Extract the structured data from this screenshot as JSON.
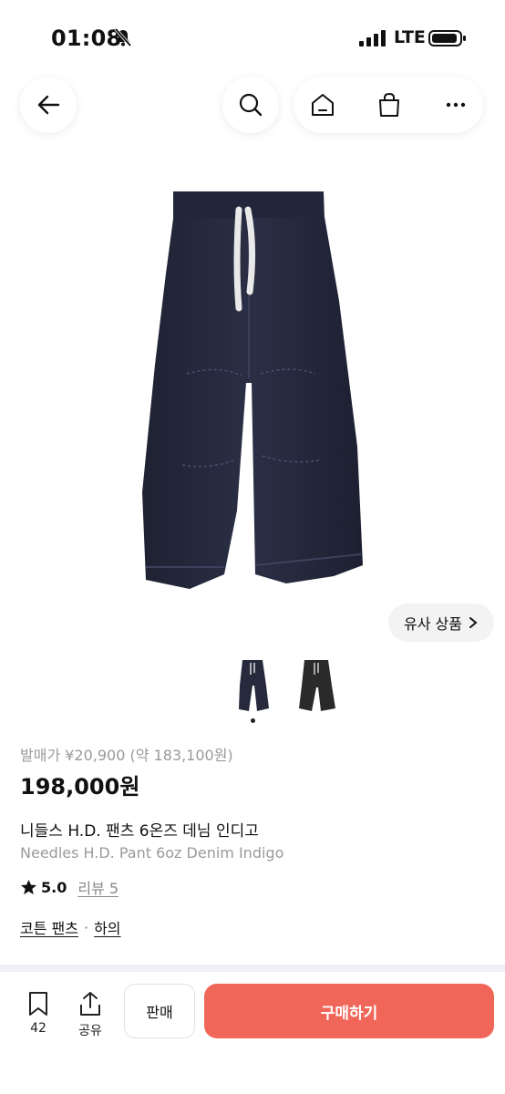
{
  "status": {
    "time": "01:08",
    "network": "LTE"
  },
  "nav": {
    "icons": [
      "back-arrow-icon",
      "search-icon",
      "home-icon",
      "shopping-bag-icon",
      "more-icon"
    ]
  },
  "gallery": {
    "similar_label": "유사 상품",
    "thumbnail_count": 2,
    "active_index": 0
  },
  "product": {
    "original_price": "발매가 ¥20,900 (약 183,100원)",
    "price": "198,000원",
    "title_ko": "니들스 H.D. 팬츠 6온즈 데님 인디고",
    "title_en": "Needles H.D. Pant 6oz Denim Indigo",
    "rating": "5.0",
    "review_label": "리뷰 5",
    "category": "코튼 팬츠",
    "category_separator": "·",
    "parent_category": "하의"
  },
  "bottom_bar": {
    "bookmark_count": "42",
    "share_label": "공유",
    "sell_label": "판매",
    "buy_label": "구매하기"
  },
  "colors": {
    "accent": "#f0675a",
    "denim": "#272a3c",
    "divider": "#eef0f6"
  }
}
